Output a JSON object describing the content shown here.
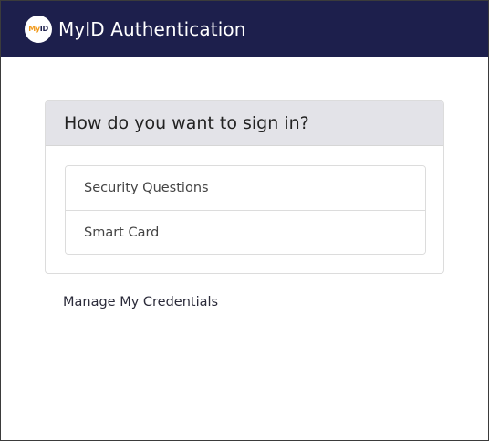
{
  "app": {
    "logo_text_my": "My",
    "logo_text_id": "ID",
    "title": "MyID Authentication"
  },
  "signin": {
    "heading": "How do you want to sign in?",
    "options": [
      {
        "label": "Security Questions"
      },
      {
        "label": "Smart Card"
      }
    ]
  },
  "links": {
    "manage_credentials": "Manage My Credentials"
  },
  "colors": {
    "header_bg": "#1d1f4c",
    "logo_accent": "#f19a1b",
    "card_header_bg": "#e3e3e8"
  },
  "icons": {
    "logo": "myid-logo-icon"
  }
}
